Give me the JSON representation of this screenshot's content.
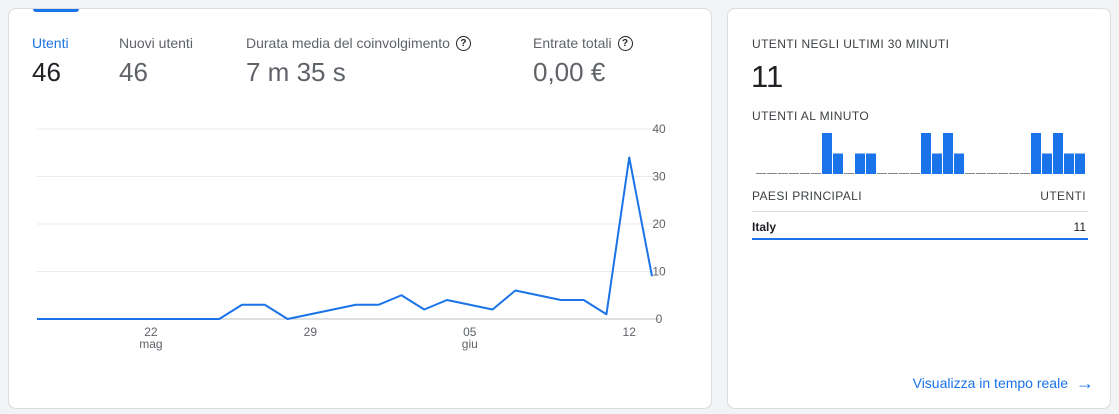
{
  "metrics": [
    {
      "label": "Utenti",
      "value": "46",
      "active": true,
      "help": false
    },
    {
      "label": "Nuovi utenti",
      "value": "46",
      "active": false,
      "help": false
    },
    {
      "label": "Durata media del coinvolgimento",
      "value": "7 m 35 s",
      "active": false,
      "help": true
    },
    {
      "label": "Entrate totali",
      "value": "0,00 €",
      "active": false,
      "help": true
    }
  ],
  "chart_data": {
    "type": "line",
    "x_ticks": [
      {
        "day": "22",
        "month": "mag"
      },
      {
        "day": "29",
        "month": ""
      },
      {
        "day": "05",
        "month": "giu"
      },
      {
        "day": "12",
        "month": ""
      }
    ],
    "x": [
      "2025-05-17",
      "2025-05-18",
      "2025-05-19",
      "2025-05-20",
      "2025-05-21",
      "2025-05-22",
      "2025-05-23",
      "2025-05-24",
      "2025-05-25",
      "2025-05-26",
      "2025-05-27",
      "2025-05-28",
      "2025-05-29",
      "2025-05-30",
      "2025-05-31",
      "2025-06-01",
      "2025-06-02",
      "2025-06-03",
      "2025-06-04",
      "2025-06-05",
      "2025-06-06",
      "2025-06-07",
      "2025-06-08",
      "2025-06-09",
      "2025-06-10",
      "2025-06-11",
      "2025-06-12",
      "2025-06-13"
    ],
    "series": [
      {
        "values": [
          0,
          0,
          0,
          0,
          0,
          0,
          0,
          0,
          0,
          3,
          3,
          0,
          1,
          2,
          3,
          3,
          5,
          2,
          4,
          3,
          2,
          6,
          5,
          4,
          4,
          1,
          34,
          9
        ]
      }
    ],
    "yticks": [
      0,
      10,
      20,
      30,
      40
    ],
    "ylim": [
      0,
      40
    ],
    "line_color": "#1a73e8",
    "grid": true
  },
  "realtime": {
    "title": "UTENTI NEGLI ULTIMI 30 MINUTI",
    "value": "11",
    "per_minute_label": "UTENTI AL MINUTO",
    "per_minute": [
      0,
      0,
      0,
      0,
      0,
      0,
      2,
      1,
      0,
      1,
      1,
      0,
      0,
      0,
      0,
      2,
      1,
      2,
      1,
      0,
      0,
      0,
      0,
      0,
      0,
      2,
      1,
      2,
      1,
      1
    ],
    "table_headers": {
      "country": "PAESI PRINCIPALI",
      "users": "UTENTI"
    },
    "rows": [
      {
        "country": "Italy",
        "users": "11"
      }
    ],
    "link_label": "Visualizza in tempo reale",
    "accent": "#1a73e8"
  }
}
